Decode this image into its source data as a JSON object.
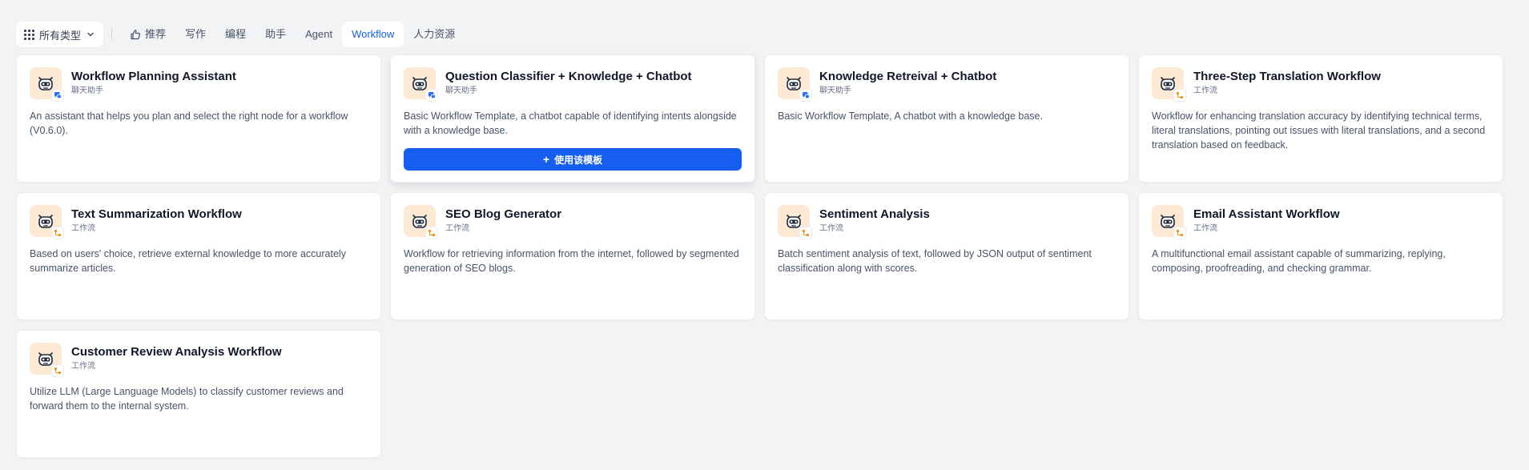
{
  "toolbar": {
    "type_select_label": "所有类型",
    "tabs": [
      {
        "label": "推荐",
        "active": false
      },
      {
        "label": "写作",
        "active": false
      },
      {
        "label": "编程",
        "active": false
      },
      {
        "label": "助手",
        "active": false
      },
      {
        "label": "Agent",
        "active": false
      },
      {
        "label": "Workflow",
        "active": true
      },
      {
        "label": "人力资源",
        "active": false
      }
    ]
  },
  "cards": [
    {
      "title": "Workflow Planning Assistant",
      "type": "聊天助手",
      "badge": "chat",
      "description": "An assistant that helps you plan and select the right node for a workflow (V0.6.0)."
    },
    {
      "title": "Question Classifier + Knowledge + Chatbot",
      "type": "聊天助手",
      "badge": "chat",
      "description": "Basic Workflow Template, a chatbot capable of identifying intents alongside with a knowledge base."
    },
    {
      "title": "Knowledge Retreival + Chatbot",
      "type": "聊天助手",
      "badge": "chat",
      "description": "Basic Workflow Template, A chatbot with a knowledge base."
    },
    {
      "title": "Three-Step Translation Workflow",
      "type": "工作流",
      "badge": "workflow",
      "description": "Workflow for enhancing translation accuracy by identifying technical terms, literal translations, pointing out issues with literal translations, and a second translation based on feedback."
    },
    {
      "title": "Text Summarization Workflow",
      "type": "工作流",
      "badge": "workflow",
      "description": "Based on users' choice, retrieve external knowledge to more accurately summarize articles."
    },
    {
      "title": "SEO Blog Generator",
      "type": "工作流",
      "badge": "workflow",
      "description": "Workflow for retrieving information from the internet, followed by segmented generation of SEO blogs."
    },
    {
      "title": "Sentiment Analysis",
      "type": "工作流",
      "badge": "workflow",
      "description": "Batch sentiment analysis of text, followed by JSON output of sentiment classification along with scores."
    },
    {
      "title": "Email Assistant Workflow",
      "type": "工作流",
      "badge": "workflow",
      "description": "A multifunctional email assistant capable of summarizing, replying, composing, proofreading, and checking grammar."
    },
    {
      "title": "Customer Review Analysis Workflow",
      "type": "工作流",
      "badge": "workflow",
      "description": "Utilize LLM (Large Language Models) to classify customer reviews and forward them to the internal system."
    }
  ],
  "use_template_label": "使用该模板",
  "colors": {
    "accent": "#155eef",
    "avatar_bg": "#fde9d4",
    "chat_badge": "#2970ff",
    "workflow_badge": "#f79009"
  }
}
